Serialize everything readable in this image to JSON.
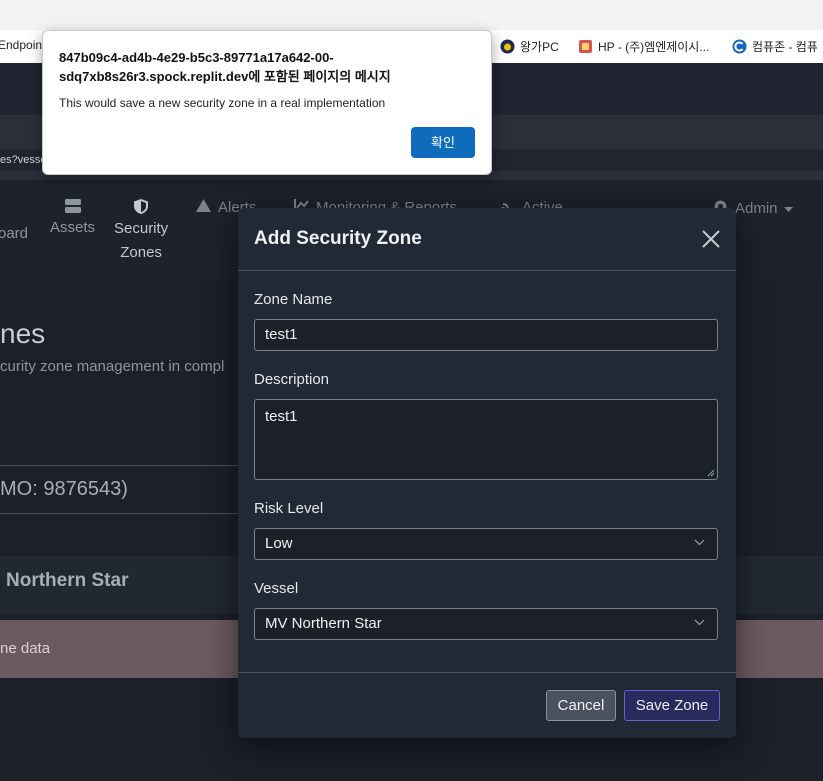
{
  "browser": {
    "bookmarks": [
      {
        "label": "Endpoin",
        "icon": "page-icon"
      },
      {
        "label": "왕가PC",
        "icon": "wangga-icon"
      },
      {
        "label": "HP - (주)엠엔제이시...",
        "icon": "hp-icon"
      },
      {
        "label": "컴퓨존 - 컴퓨",
        "icon": "compuzone-icon"
      }
    ],
    "address": "es?vesse"
  },
  "nav": {
    "dashboard": "oard",
    "assets": "Assets",
    "security_zones_line1": "Security",
    "security_zones_line2": "Zones",
    "alerts": "Alerts",
    "monitoring": "Monitoring & Reports",
    "active": "Active",
    "admin": "Admin"
  },
  "page": {
    "title": "nes",
    "subtitle": "curity zone management in compl",
    "vessel_line": "MO: 9876543)",
    "northern": "Northern Star",
    "alert_text": "ne data"
  },
  "modal": {
    "title": "Add Security Zone",
    "zone_name_label": "Zone Name",
    "zone_name_value": "test1",
    "description_label": "Description",
    "description_value": "test1",
    "risk_label": "Risk Level",
    "risk_value": "Low",
    "vessel_label": "Vessel",
    "vessel_value": "MV Northern Star",
    "cancel": "Cancel",
    "save": "Save Zone"
  },
  "dialog": {
    "title": "847b09c4-ad4b-4e29-b5c3-89771a17a642-00-sdq7xb8s26r3.spock.replit.dev에 포함된 페이지의 메시지",
    "message": "This would save a new security zone in a real implementation",
    "ok": "확인"
  },
  "colors": {
    "modal_bg": "#222834",
    "save_button": "#2b2a5e",
    "dialog_ok": "#0f6cbd",
    "alert_band": "#6b5a5f"
  }
}
